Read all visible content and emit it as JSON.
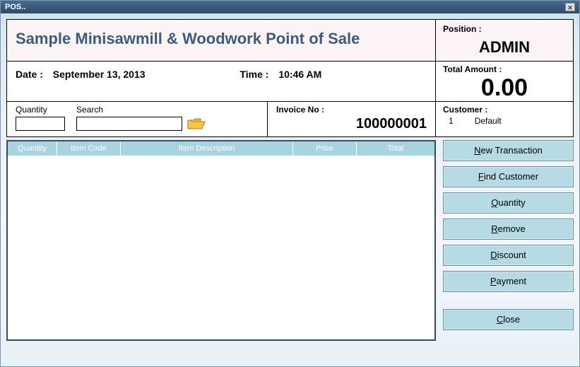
{
  "window": {
    "title": "POS.."
  },
  "header": {
    "app_title": "Sample Minisawmill & Woodwork Point of Sale",
    "position_label": "Position :",
    "position_value": "ADMIN"
  },
  "datetime": {
    "date_label": "Date :",
    "date_value": "September 13, 2013",
    "time_label": "Time :",
    "time_value": "10:46 AM"
  },
  "total": {
    "label": "Total Amount :",
    "amount": "0.00"
  },
  "search": {
    "quantity_label": "Quantity",
    "quantity_value": "",
    "search_label": "Search",
    "search_value": ""
  },
  "invoice": {
    "label": "Invoice No :",
    "value": "100000001"
  },
  "customer": {
    "label": "Customer :",
    "id": "1",
    "name": "Default"
  },
  "grid": {
    "columns": {
      "qty": "Quantity",
      "code": "Item Code",
      "desc": "Item Description",
      "price": "Price",
      "total": "Total"
    }
  },
  "actions": {
    "new_transaction": "ew Transaction",
    "new_transaction_u": "N",
    "find_customer": "ind Customer",
    "find_customer_u": "F",
    "quantity": "uantity",
    "quantity_u": "Q",
    "remove": "emove",
    "remove_u": "R",
    "discount": "iscount",
    "discount_u": "D",
    "payment": "ayment",
    "payment_u": "P",
    "close": "lose",
    "close_u": "C"
  }
}
